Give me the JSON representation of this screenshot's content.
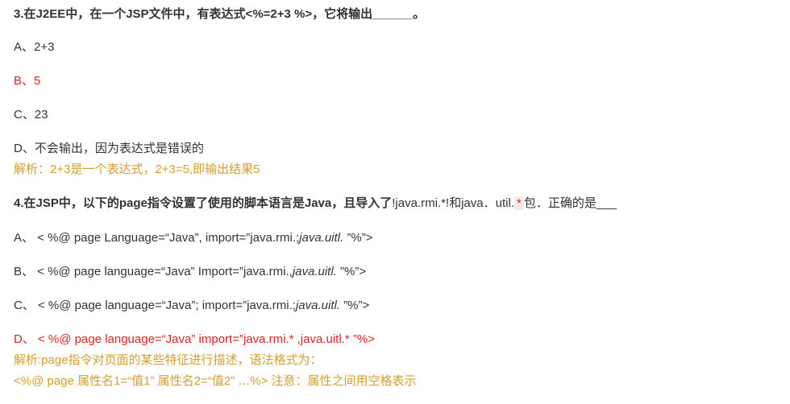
{
  "q3": {
    "title": "3.在J2EE中，在一个JSP文件中，有表达式<%=2+3 %>，它将输出______。",
    "options": [
      "A、2+3",
      "B、5",
      "C、23",
      "D、不会输出，因为表达式是错误的"
    ],
    "explanation": "解析：2+3是一个表达式，2+3=5,即输出结果5"
  },
  "q4": {
    "title_bold": "4.在JSP中，以下的page指令设置了使用的脚本语言是Java，且导入了",
    "title_normal_1": "!java.rmi.*!和java．util.",
    "title_highlight": "*",
    "title_normal_2": "包．正确的是___",
    "option_a_prefix": "A、 < %@ page Language=“Java”, import=”java.rmi.;",
    "option_a_italic": "java.uitl.",
    "option_a_suffix": " ”%”>",
    "option_b_prefix": "B、 < %@ page language=“Java” Import=”java.rmi.,",
    "option_b_italic": "java.uitl.",
    "option_b_suffix": " ”%”>",
    "option_c_prefix": "C、 < %@ page language=“Java”; import=”java.rmi.;",
    "option_c_italic": "java.uitl.",
    "option_c_suffix": " ”%”>",
    "option_d": "D、 < %@ page language=“Java” import=”java.rmi.* ,java.uitl.* ”%>",
    "explanation_1": "解析:page指令对页面的某些特征进行描述，语法格式为：",
    "explanation_2": "<%@ page 属性名1=“值1” 属性名2=“值2” …%> 注意：属性之间用空格表示"
  }
}
